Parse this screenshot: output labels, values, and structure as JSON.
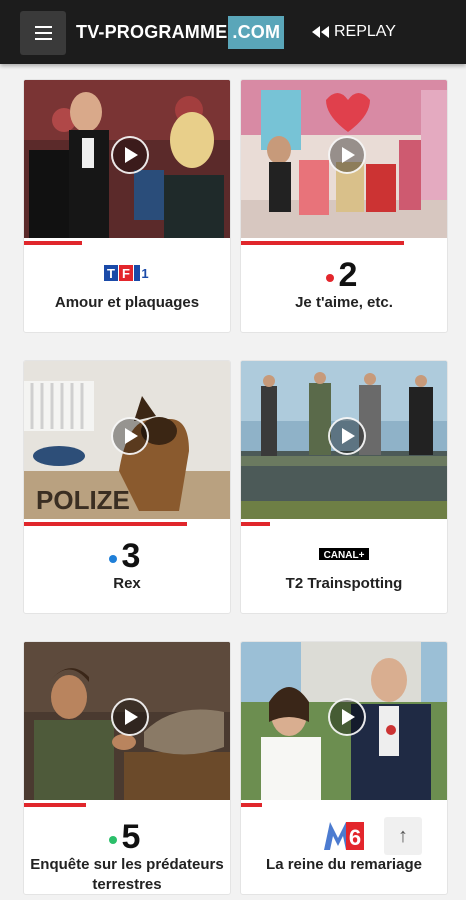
{
  "header": {
    "brand_main": "TV-PROGRAMME",
    "brand_tld": ".COM",
    "replay_label": "REPLAY"
  },
  "programmes": [
    {
      "title": "Amour et plaquages",
      "channel": "TF1",
      "progress": 0.28
    },
    {
      "title": "Je t'aime, etc.",
      "channel": "2",
      "progress": 0.79
    },
    {
      "title": "Rex",
      "channel": "3",
      "progress": 0.79
    },
    {
      "title": "T2 Trainspotting",
      "channel": "CANAL+",
      "progress": 0.14
    },
    {
      "title": "Enquête sur les prédateurs terrestres",
      "channel": "5",
      "progress": 0.3
    },
    {
      "title": "La reine du remariage",
      "channel": "6",
      "progress": 0.1
    }
  ],
  "scroll_top_label": "↑"
}
